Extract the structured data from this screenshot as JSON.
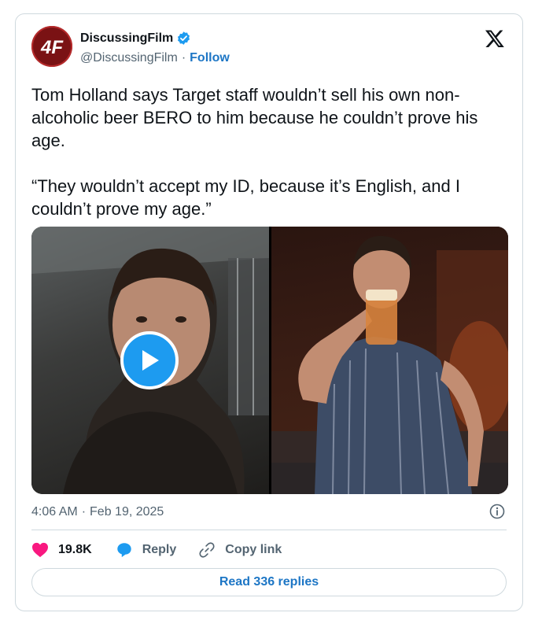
{
  "author": {
    "name": "DiscussingFilm",
    "handle": "@DiscussingFilm",
    "separator": "·",
    "follow_label": "Follow",
    "avatar_text": "4F",
    "verified": true
  },
  "tweet": {
    "paragraphs": [
      "Tom Holland says Target staff wouldn’t sell his own non-alcoholic beer BERO to him because he couldn’t prove his age.",
      "“They wouldn’t accept my ID, because it’s English, and I couldn’t prove my age.”"
    ],
    "time": "4:06 AM",
    "separator": "·",
    "date": "Feb 19, 2025"
  },
  "actions": {
    "likes": "19.8K",
    "reply_label": "Reply",
    "copy_link_label": "Copy link",
    "read_replies_label": "Read 336 replies"
  },
  "icons": {
    "platform": "x-logo-icon",
    "verified": "verified-badge-icon",
    "play": "play-icon",
    "info": "info-icon",
    "like": "heart-icon",
    "reply": "reply-bubble-icon",
    "copy_link": "link-icon"
  },
  "colors": {
    "accent": "#1d9bf0",
    "link": "#1d76c5",
    "like": "#f91880",
    "muted": "#536471",
    "border": "#cfd9de",
    "avatar_bg": "#7a1214"
  }
}
